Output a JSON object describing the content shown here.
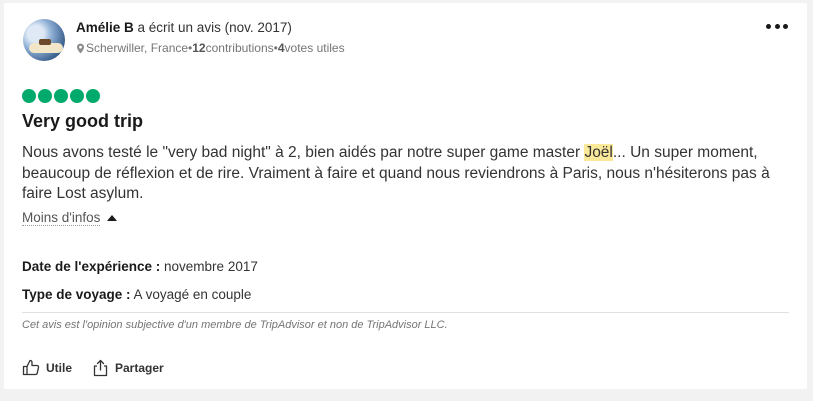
{
  "review": {
    "author": {
      "name": "Amélie B",
      "action_text": " a écrit un avis (nov. 2017)",
      "location": "Scherwiller, France",
      "separator1": " • ",
      "contributions_count": "12",
      "contributions_label": " contributions",
      "separator2": " • ",
      "votes_count": "4",
      "votes_label": " votes utiles",
      "avatar_icon": "avatar-photo-icon"
    },
    "rating": {
      "value": 5,
      "max": 5,
      "color": "#00aa6c"
    },
    "title": "Very good trip",
    "body_part1": "Nous avons testé le \"very bad night\" à 2, bien aidés par notre super game master ",
    "body_highlight": "Joël",
    "body_part2": "... Un super moment, beaucoup de réflexion et de rire. Vraiment à faire et quand nous reviendrons à Paris, nous n'hésiterons pas à faire Lost asylum.",
    "highlight_color": "#fbe99a",
    "less_info_label": "Moins d'infos",
    "experience_date_label": "Date de l'expérience :",
    "experience_date_value": " novembre 2017",
    "trip_type_label": "Type de voyage :",
    "trip_type_value": " A voyagé en couple",
    "disclaimer": "Cet avis est l'opinion subjective d'un membre de TripAdvisor et non de TripAdvisor LLC.",
    "actions": {
      "helpful_label": "Utile",
      "share_label": "Partager"
    },
    "icons": [
      "more-options-icon",
      "location-pin-icon",
      "caret-up-icon",
      "thumbs-up-icon",
      "share-icon"
    ]
  }
}
